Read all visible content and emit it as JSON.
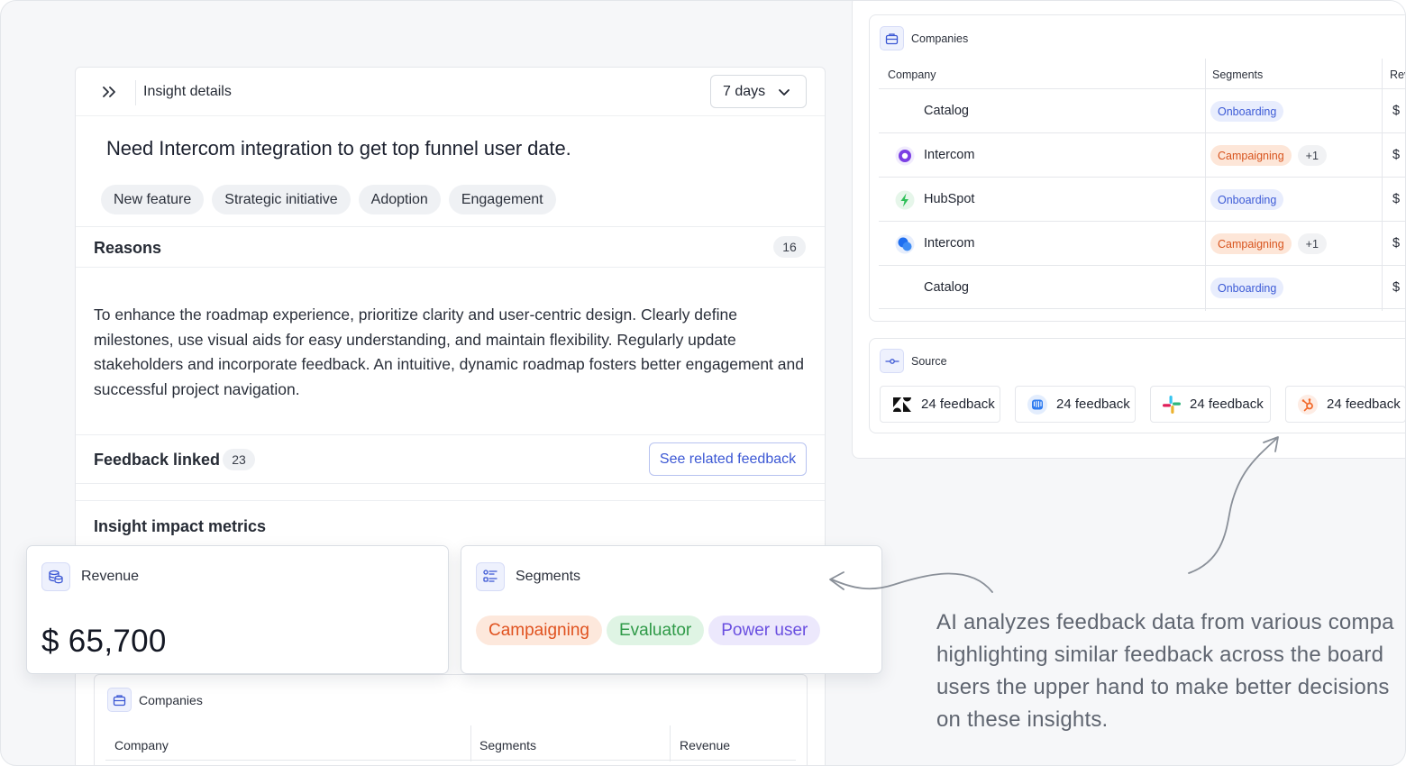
{
  "header": {
    "title": "Insight details",
    "range_label": "7 days"
  },
  "insight": {
    "title": "Need Intercom integration to get top funnel user date.",
    "tags": [
      "New feature",
      "Strategic initiative",
      "Adoption",
      "Engagement"
    ]
  },
  "reasons": {
    "title": "Reasons",
    "count": "16",
    "text": "To enhance the roadmap experience, prioritize clarity and user-centric design. Clearly define milestones, use visual aids for easy understanding, and maintain flexibility. Regularly update stakeholders and incorporate feedback. An intuitive, dynamic roadmap fosters better engagement and successful project navigation."
  },
  "feedback": {
    "title": "Feedback linked",
    "count": "23",
    "button_label": "See related feedback"
  },
  "metrics": {
    "title": "Insight impact metrics"
  },
  "revenue_card": {
    "title": "Revenue",
    "value": "$ 65,700"
  },
  "segments_card": {
    "title": "Segments",
    "pills": [
      {
        "label": "Campaigning",
        "bg": "#fde8dc",
        "fg": "#e0521f"
      },
      {
        "label": "Evaluator",
        "bg": "#dff4e4",
        "fg": "#2f9a48"
      },
      {
        "label": "Power user",
        "bg": "#ece8fc",
        "fg": "#6a4fe0"
      }
    ]
  },
  "sub_companies": {
    "title": "Companies",
    "col_company": "Company",
    "col_segments": "Segments",
    "col_revenue": "Revenue"
  },
  "companies_panel": {
    "title": "Companies",
    "col_company": "Company",
    "col_segments": "Segments",
    "col_revenue": "Rev",
    "rows": [
      {
        "name": "Catalog",
        "logo": "none",
        "segment": "Onboarding",
        "extra": "",
        "revenue": "$"
      },
      {
        "name": "Intercom",
        "logo": "intercom-purple",
        "segment": "Campaigning",
        "extra": "+1",
        "revenue": "$"
      },
      {
        "name": "HubSpot",
        "logo": "hubspot-green",
        "segment": "Onboarding",
        "extra": "",
        "revenue": "$"
      },
      {
        "name": "Intercom",
        "logo": "intercom-blue",
        "segment": "Campaigning",
        "extra": "+1",
        "revenue": "$"
      },
      {
        "name": "Catalog",
        "logo": "none",
        "segment": "Onboarding",
        "extra": "",
        "revenue": "$"
      }
    ]
  },
  "source_panel": {
    "title": "Source",
    "items": [
      {
        "icon": "zendesk-icon",
        "label": "24 feedback"
      },
      {
        "icon": "intercom-icon",
        "label": "24 feedback"
      },
      {
        "icon": "slack-icon",
        "label": "24 feedback"
      },
      {
        "icon": "hubspot-icon",
        "label": "24 feedback"
      }
    ]
  },
  "annotation": {
    "lines": [
      "AI analyzes feedback data from various compa",
      "highlighting similar feedback across the board",
      "users the upper hand to make better decisions",
      "on these insights."
    ]
  },
  "colors": {
    "accent": "#3b57d4",
    "onboarding_bg": "#e8edfd",
    "onboarding_fg": "#3d5bd6",
    "campaigning_bg": "#fde6d8",
    "campaigning_fg": "#d8541e"
  }
}
